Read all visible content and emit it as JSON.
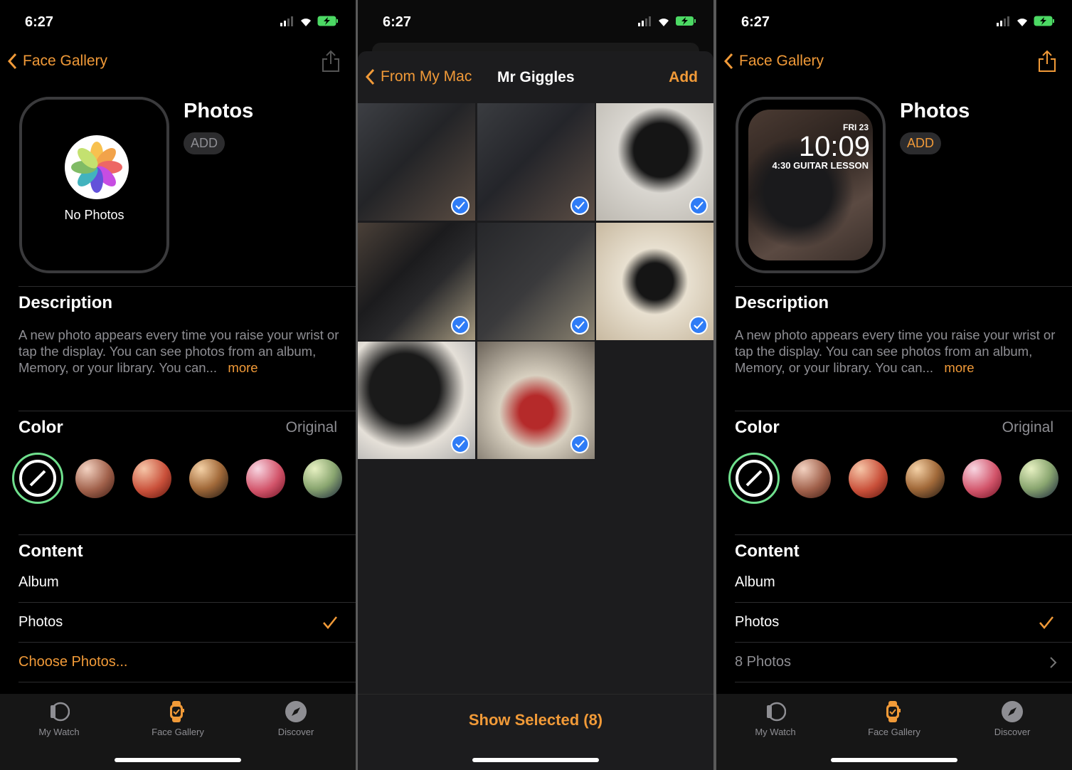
{
  "colors": {
    "accent": "#f19a38",
    "selected_ring": "#6fe08d",
    "check_blue": "#2f7cf6"
  },
  "status": {
    "time": "6:27"
  },
  "panels": [
    {
      "back": "Face Gallery",
      "title": "Photos",
      "add": "ADD",
      "preview_text": "No Photos",
      "description_heading": "Description",
      "description": "A new photo appears every time you raise your wrist or tap the display. You can see photos from an album, Memory, or your library. You can...",
      "more": "more",
      "color_heading": "Color",
      "color_value": "Original",
      "content_heading": "Content",
      "album_label": "Album",
      "photos_label": "Photos",
      "last_row": "Choose Photos...",
      "tabs": [
        "My Watch",
        "Face Gallery",
        "Discover"
      ]
    },
    {
      "back": "Face Gallery",
      "title": "Photos",
      "add": "ADD",
      "face": {
        "date": "FRI 23",
        "time": "10:09",
        "event": "4:30 GUITAR LESSON"
      },
      "description_heading": "Description",
      "description": "A new photo appears every time you raise your wrist or tap the display. You can see photos from an album, Memory, or your library. You can...",
      "more": "more",
      "color_heading": "Color",
      "color_value": "Original",
      "content_heading": "Content",
      "album_label": "Album",
      "photos_label": "Photos",
      "last_row": "8 Photos",
      "tabs": [
        "My Watch",
        "Face Gallery",
        "Discover"
      ]
    }
  ],
  "picker": {
    "back": "From My Mac",
    "title": "Mr Giggles",
    "add": "Add",
    "show_selected": "Show Selected (8)",
    "photo_count": 8,
    "selected_count": 8
  }
}
